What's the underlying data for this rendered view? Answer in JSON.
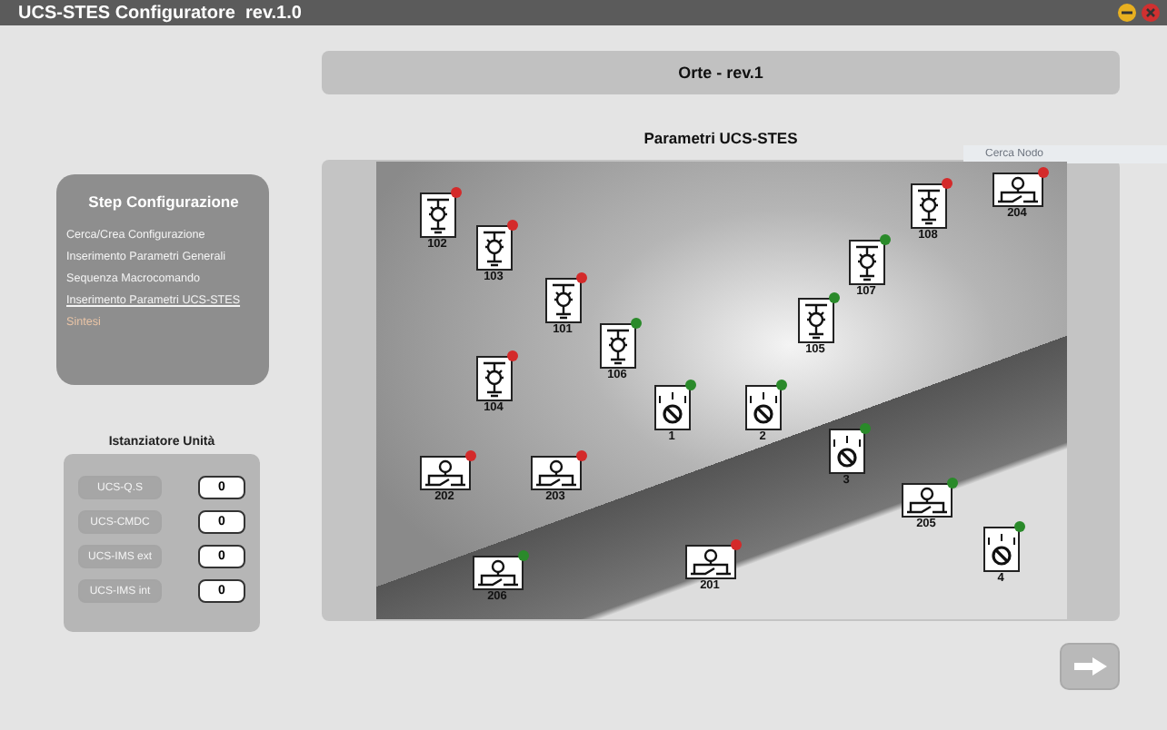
{
  "window": {
    "title": "UCS-STES Configuratore  rev.1.0"
  },
  "header": {
    "title": "Orte - rev.1"
  },
  "search": {
    "placeholder": "Cerca Nodo"
  },
  "steps": {
    "title": "Step Configurazione",
    "items": [
      {
        "label": "Cerca/Crea Configurazione",
        "selected": false,
        "disabled": false
      },
      {
        "label": "Inserimento Parametri Generali",
        "selected": false,
        "disabled": false
      },
      {
        "label": "Sequenza Macrocomando",
        "selected": false,
        "disabled": false
      },
      {
        "label": "Inserimento Parametri UCS-STES",
        "selected": true,
        "disabled": false
      },
      {
        "label": "Sintesi",
        "selected": false,
        "disabled": true
      }
    ]
  },
  "units": {
    "title": "Istanziatore Unità",
    "rows": [
      {
        "label": "UCS-Q.S",
        "disabled": true,
        "value": "0"
      },
      {
        "label": "UCS-CMDC",
        "disabled": true,
        "value": "0"
      },
      {
        "label": "UCS-IMS ext",
        "disabled": true,
        "value": "0"
      },
      {
        "label": "UCS-IMS int",
        "disabled": true,
        "value": "0"
      }
    ]
  },
  "diagram": {
    "title": "Parametri UCS-STES",
    "nodes": [
      {
        "kind": "sectioner",
        "label": "102",
        "color": "#d42a2a"
      },
      {
        "kind": "sectioner",
        "label": "103",
        "color": "#d42a2a"
      },
      {
        "kind": "sectioner",
        "label": "101",
        "color": "#d42a2a"
      },
      {
        "kind": "sectioner",
        "label": "106",
        "color": "#2a8a2a"
      },
      {
        "kind": "sectioner",
        "label": "104",
        "color": "#d42a2a"
      },
      {
        "kind": "selector",
        "label": "1",
        "color": "#2a8a2a"
      },
      {
        "kind": "switch",
        "label": "202",
        "color": "#d42a2a"
      },
      {
        "kind": "switch",
        "label": "203",
        "color": "#d42a2a"
      },
      {
        "kind": "switch",
        "label": "206",
        "color": "#2a8a2a"
      },
      {
        "kind": "switch",
        "label": "201",
        "color": "#d42a2a"
      },
      {
        "kind": "sectioner",
        "label": "108",
        "color": "#d42a2a"
      },
      {
        "kind": "switch",
        "label": "204",
        "color": "#d42a2a"
      },
      {
        "kind": "sectioner",
        "label": "107",
        "color": "#2a8a2a"
      },
      {
        "kind": "sectioner",
        "label": "105",
        "color": "#2a8a2a"
      },
      {
        "kind": "selector",
        "label": "2",
        "color": "#2a8a2a"
      },
      {
        "kind": "selector",
        "label": "3",
        "color": "#2a8a2a"
      },
      {
        "kind": "switch",
        "label": "205",
        "color": "#2a8a2a"
      },
      {
        "kind": "selector",
        "label": "4",
        "color": "#2a8a2a"
      }
    ]
  }
}
